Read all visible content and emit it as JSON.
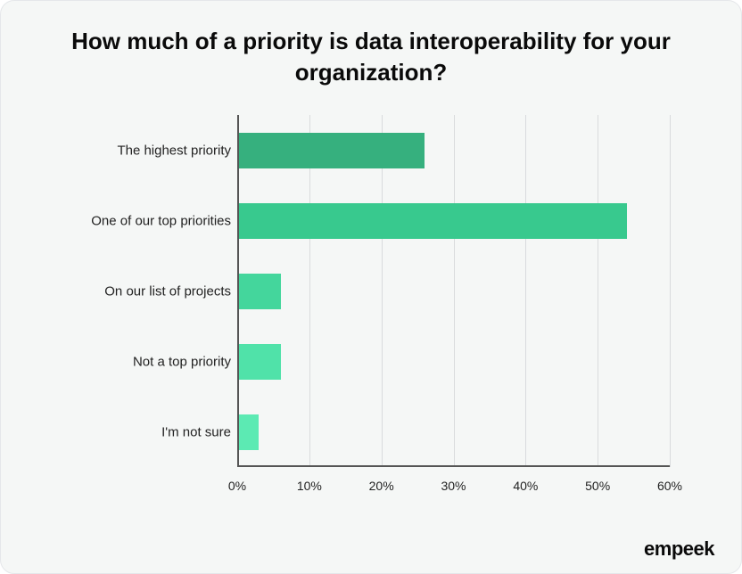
{
  "title": "How much of a priority is data interoperability for your organization?",
  "brand": "empeek",
  "chart_data": {
    "type": "bar",
    "orientation": "horizontal",
    "categories": [
      "The highest priority",
      "One of our top priorities",
      "On our list of projects",
      "Not a top priority",
      "I'm not sure"
    ],
    "values": [
      26,
      54,
      6,
      6,
      3
    ],
    "colors": [
      "#36b07e",
      "#38c98e",
      "#44d69c",
      "#50e2a9",
      "#5ceab3"
    ],
    "xlabel": "",
    "ylabel": "",
    "xlim": [
      0,
      60
    ],
    "xticks": [
      0,
      10,
      20,
      30,
      40,
      50,
      60
    ],
    "xtick_suffix": "%"
  }
}
